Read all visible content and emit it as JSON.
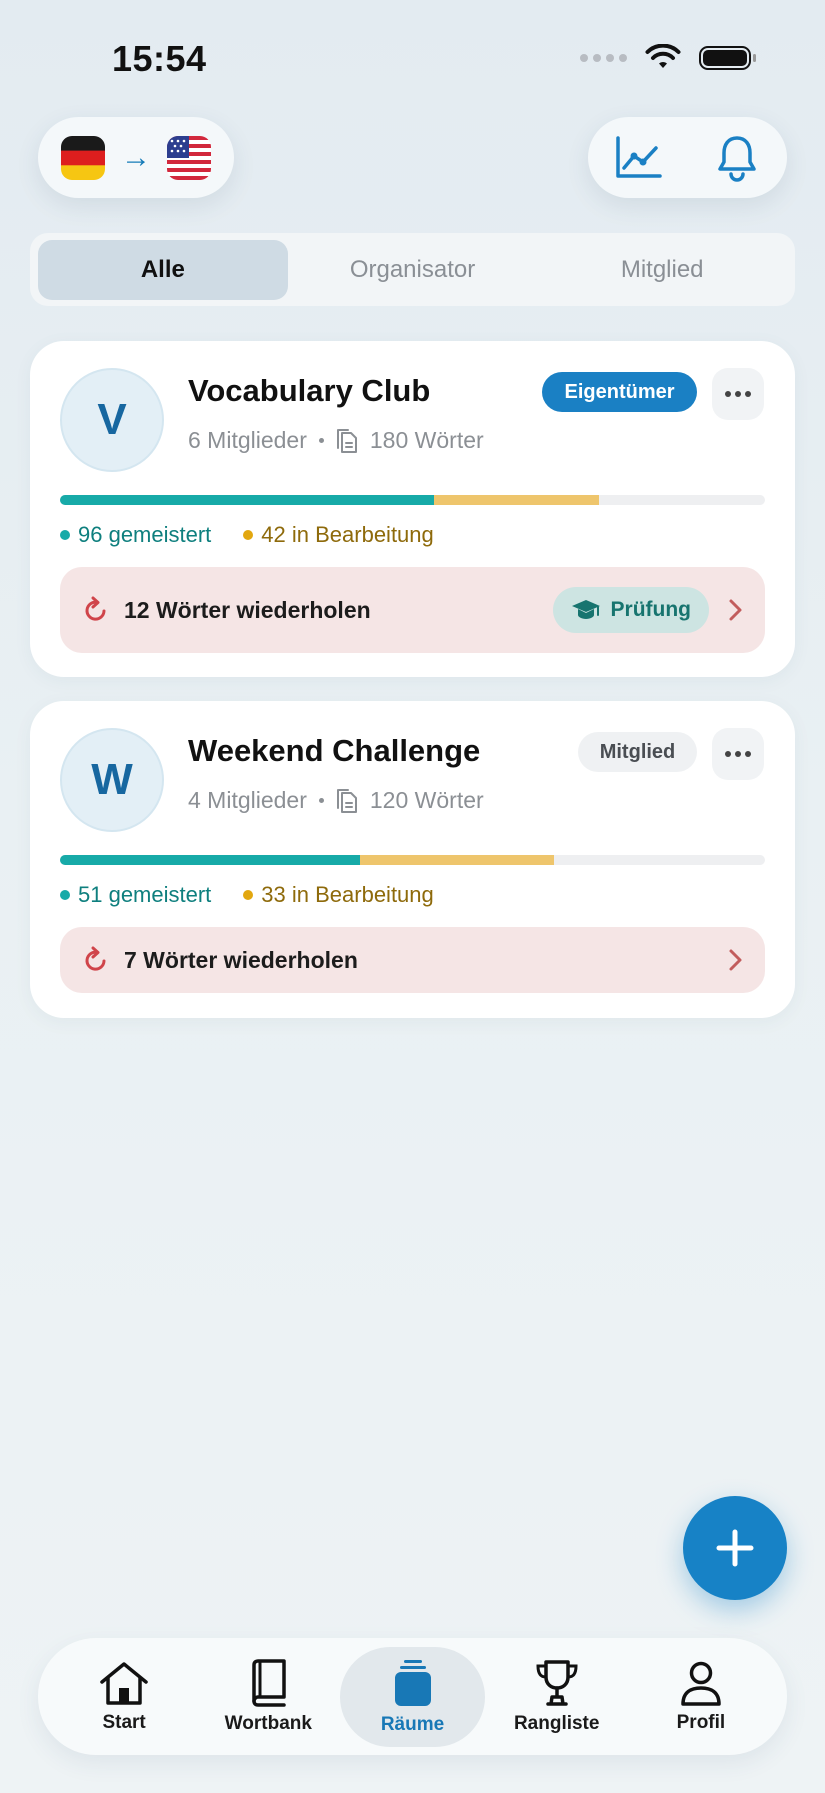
{
  "status_bar": {
    "time": "15:54"
  },
  "header": {
    "language_pair": {
      "from": "de-flag-icon",
      "to": "us-flag-icon"
    },
    "actions": [
      "chart-icon",
      "bell-icon"
    ]
  },
  "segments": [
    {
      "label": "Alle",
      "active": true
    },
    {
      "label": "Organisator",
      "active": false
    },
    {
      "label": "Mitglied",
      "active": false
    }
  ],
  "rooms": [
    {
      "initial": "V",
      "name": "Vocabulary Club",
      "members": "6 Mitglieder",
      "words": "180 Wörter",
      "role": "Eigentümer",
      "mastered_label": "96 gemeistert",
      "in_progress_label": "42 in Bearbeitung",
      "mastered_fraction": 0.53,
      "in_progress_fraction": 0.234,
      "review_label": "12 Wörter wiederholen",
      "exam_label": "Prüfung"
    },
    {
      "initial": "W",
      "name": "Weekend Challenge",
      "members": "4 Mitglieder",
      "words": "120 Wörter",
      "role": "Mitglied",
      "mastered_label": "51 gemeistert",
      "in_progress_label": "33 in Bearbeitung",
      "mastered_fraction": 0.425,
      "in_progress_fraction": 0.275,
      "review_label": "7 Wörter wiederholen"
    }
  ],
  "tabbar": [
    {
      "label": "Start",
      "icon": "home-icon",
      "active": false
    },
    {
      "label": "Wortbank",
      "icon": "book-icon",
      "active": false
    },
    {
      "label": "Räume",
      "icon": "stack-icon",
      "active": true
    },
    {
      "label": "Rangliste",
      "icon": "trophy-icon",
      "active": false
    },
    {
      "label": "Profil",
      "icon": "person-icon",
      "active": false
    }
  ],
  "colors": {
    "accent": "#1782c6",
    "mastered": "#17aaa8",
    "in_progress": "#eec56c",
    "review_bg": "#f5e5e5"
  }
}
